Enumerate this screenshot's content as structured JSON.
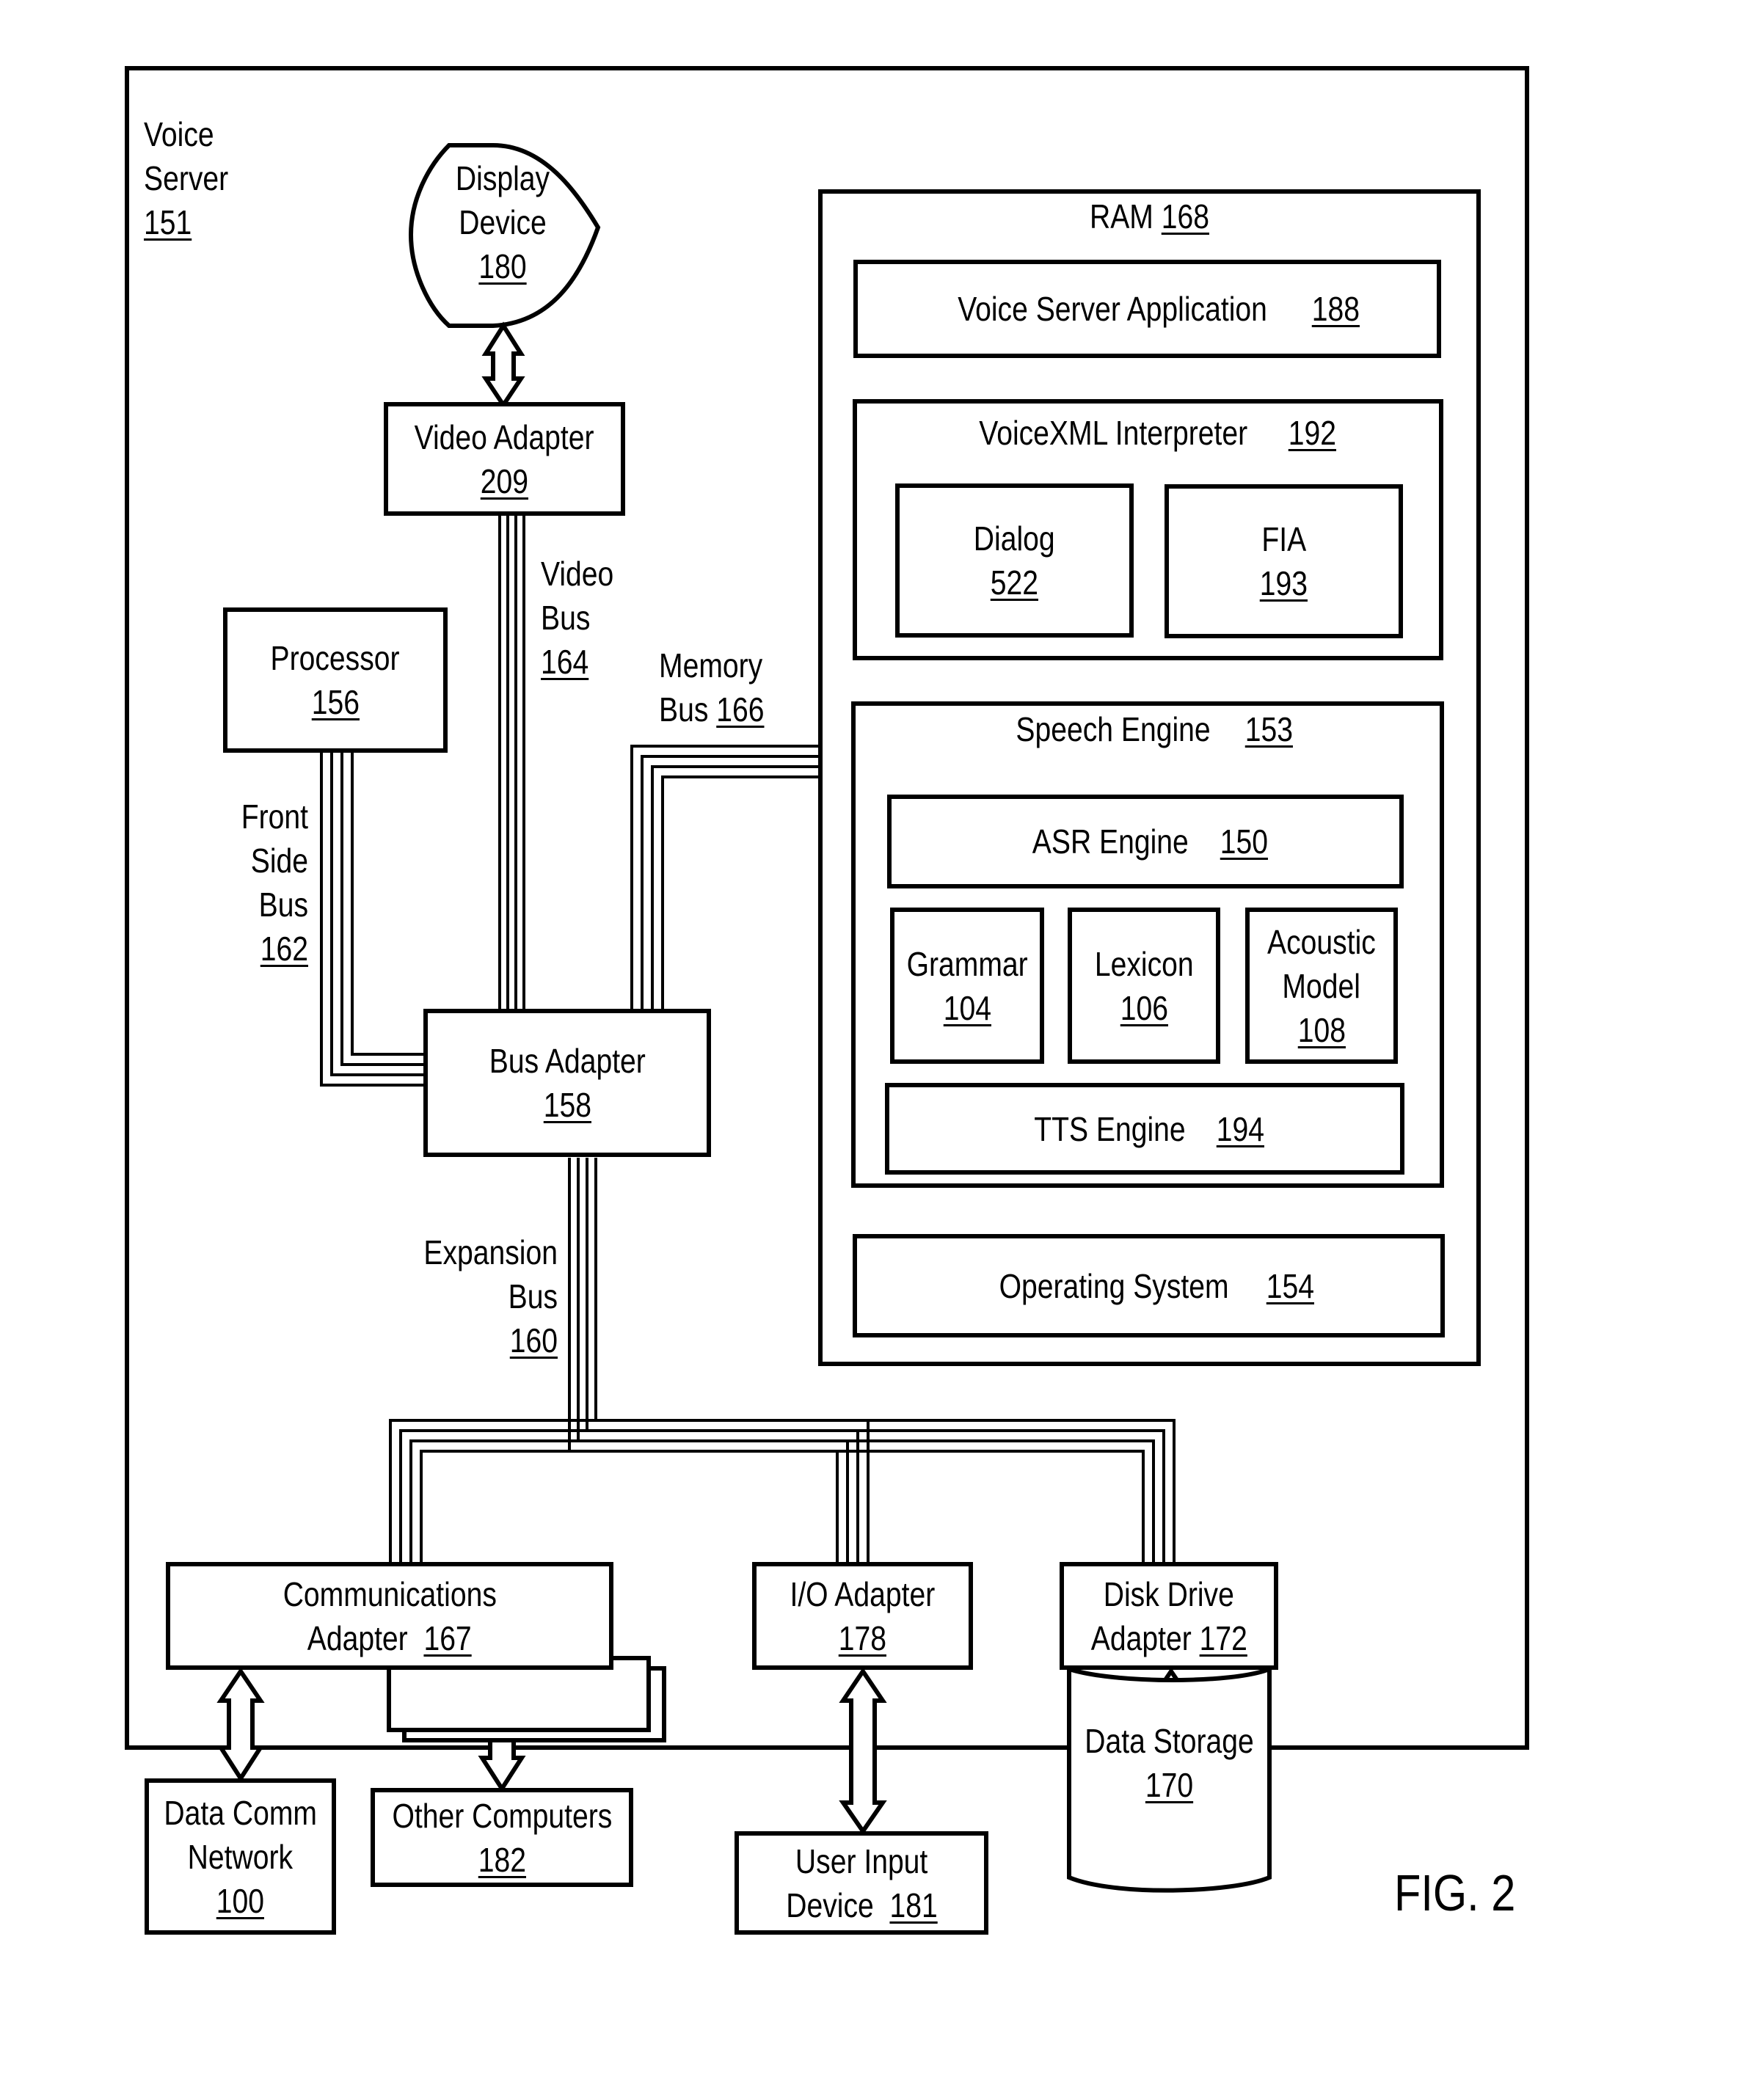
{
  "figure": {
    "label": "FIG. 2",
    "voice_server": {
      "name_line1": "Voice",
      "name_line2": "Server",
      "ref": "151"
    },
    "display_device": {
      "line1": "Display",
      "line2": "Device",
      "ref": "180"
    },
    "video_adapter": {
      "name": "Video Adapter",
      "ref": "209"
    },
    "video_bus": {
      "line1": "Video",
      "line2": "Bus",
      "ref": "164"
    },
    "processor": {
      "name": "Processor",
      "ref": "156"
    },
    "front_side_bus": {
      "line1": "Front",
      "line2": "Side",
      "line3": "Bus",
      "ref": "162"
    },
    "memory_bus": {
      "line1": "Memory",
      "line2": "Bus",
      "ref": "166"
    },
    "bus_adapter": {
      "name": "Bus Adapter",
      "ref": "158"
    },
    "expansion_bus": {
      "line1": "Expansion",
      "line2": "Bus",
      "ref": "160"
    },
    "ram": {
      "name": "RAM",
      "ref": "168",
      "voice_server_application": {
        "name": "Voice Server Application",
        "ref": "188"
      },
      "voicexml_interpreter": {
        "name": "VoiceXML Interpreter",
        "ref": "192",
        "dialog": {
          "name": "Dialog",
          "ref": "522"
        },
        "fia": {
          "name": "FIA",
          "ref": "193"
        }
      },
      "speech_engine": {
        "name": "Speech Engine",
        "ref": "153",
        "asr_engine": {
          "name": "ASR Engine",
          "ref": "150"
        },
        "grammar": {
          "name": "Grammar",
          "ref": "104"
        },
        "lexicon": {
          "name": "Lexicon",
          "ref": "106"
        },
        "acoustic_model": {
          "line1": "Acoustic",
          "line2": "Model",
          "ref": "108"
        },
        "tts_engine": {
          "name": "TTS Engine",
          "ref": "194"
        }
      },
      "operating_system": {
        "name": "Operating System",
        "ref": "154"
      }
    },
    "communications_adapter": {
      "line1": "Communications",
      "line2": "Adapter",
      "ref": "167"
    },
    "io_adapter": {
      "name": "I/O Adapter",
      "ref": "178"
    },
    "disk_drive_adapter": {
      "line1": "Disk Drive",
      "line2": "Adapter",
      "ref": "172"
    },
    "data_comm_network": {
      "line1": "Data Comm",
      "line2": "Network",
      "ref": "100"
    },
    "other_computers": {
      "name": "Other Computers",
      "ref": "182"
    },
    "user_input_device": {
      "line1": "User Input",
      "line2": "Device",
      "ref": "181"
    },
    "data_storage": {
      "name": "Data Storage",
      "ref": "170"
    }
  }
}
